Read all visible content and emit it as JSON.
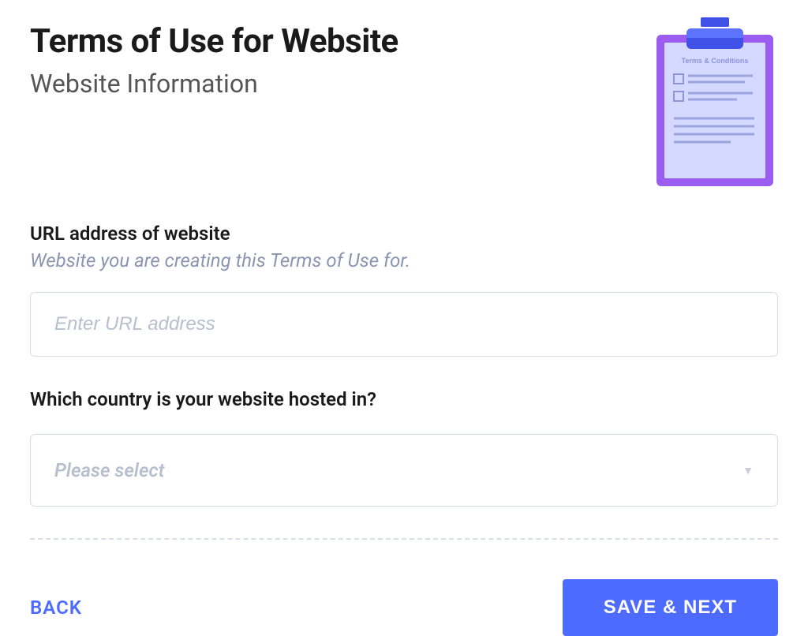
{
  "header": {
    "title": "Terms of Use for Website",
    "subtitle": "Website Information"
  },
  "illustration": {
    "caption": "Terms & Conditions"
  },
  "fields": {
    "url": {
      "label": "URL address of website",
      "hint": "Website you are creating this Terms of Use for.",
      "placeholder": "Enter URL address",
      "value": ""
    },
    "country": {
      "label": "Which country is your website hosted in?",
      "placeholder": "Please select",
      "value": ""
    }
  },
  "footer": {
    "back_label": "BACK",
    "next_label": "SAVE & NEXT"
  },
  "colors": {
    "primary": "#4d6bff",
    "clipboard_frame": "#9b5cf0",
    "clipboard_paper": "#d5d8ff",
    "clip_dark": "#3f51e6"
  }
}
